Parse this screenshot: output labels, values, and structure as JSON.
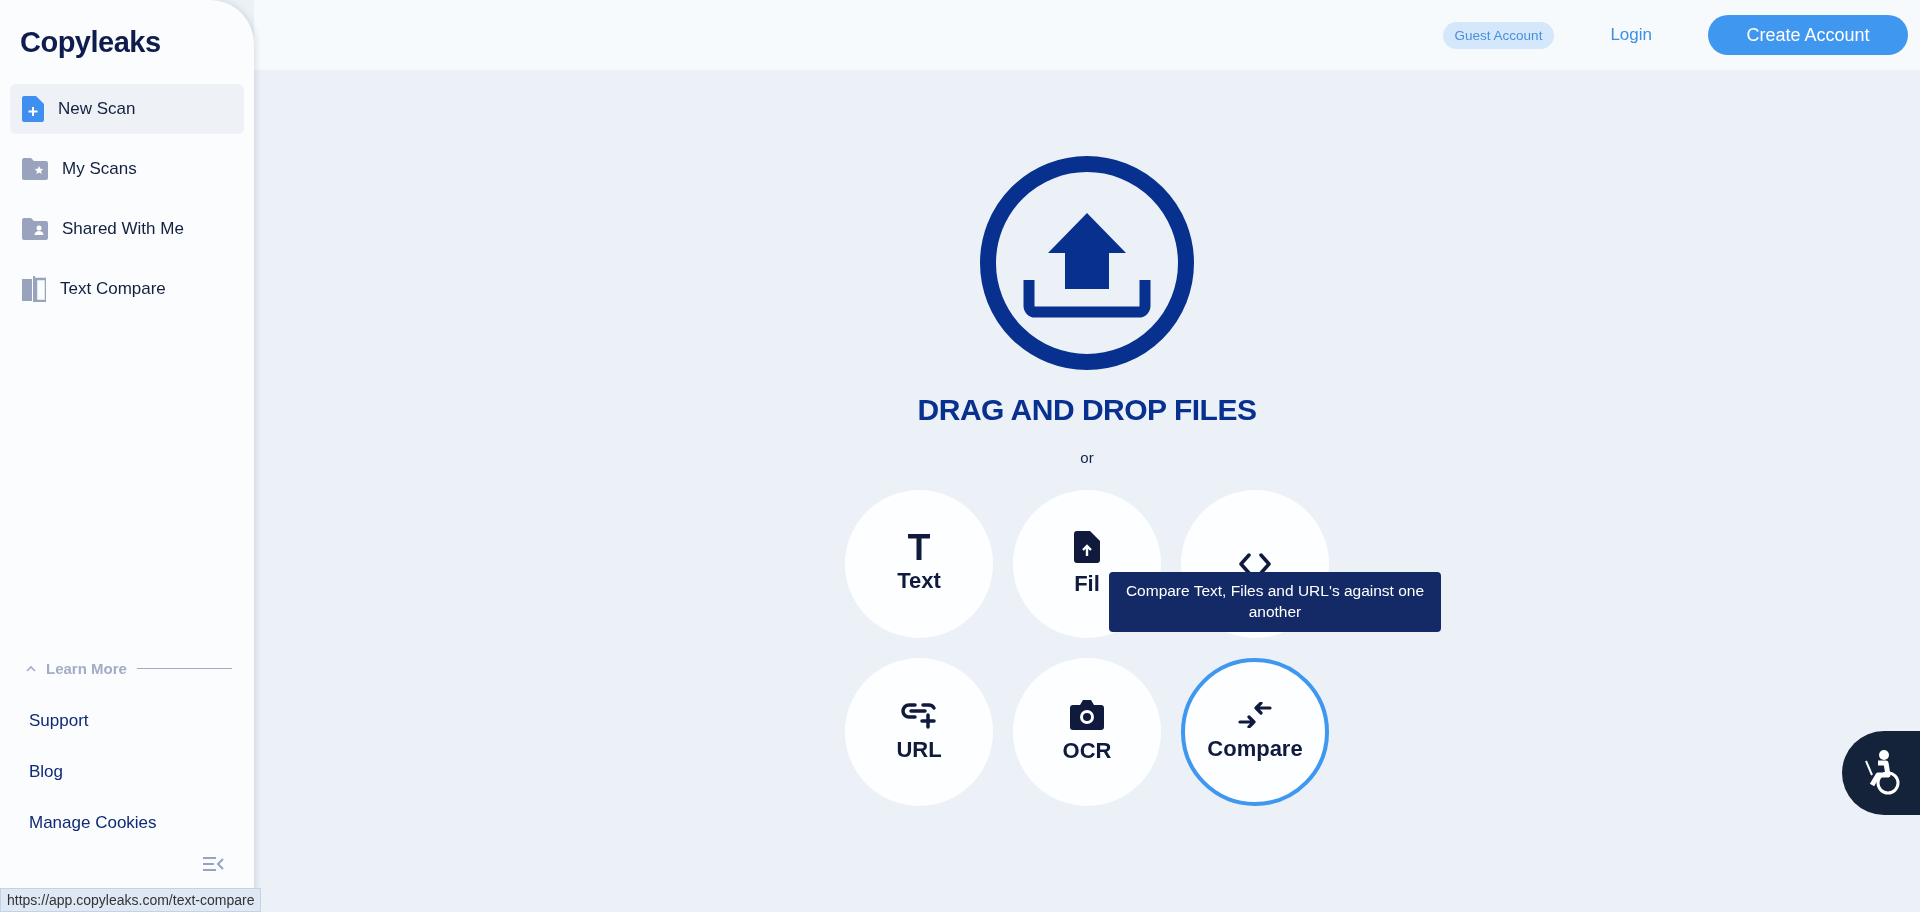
{
  "sidebar": {
    "logo": "Copyleaks",
    "items": [
      {
        "label": "New Scan",
        "kind": "new",
        "selected": true
      },
      {
        "label": "My Scans",
        "kind": "starred",
        "selected": false
      },
      {
        "label": "Shared With Me",
        "kind": "shared",
        "selected": false
      },
      {
        "label": "Text Compare",
        "kind": "compare",
        "selected": false
      }
    ],
    "learn_more": {
      "title": "Learn More",
      "expanded": true,
      "links": [
        "Support",
        "Blog",
        "Manage Cookies"
      ]
    }
  },
  "header": {
    "badge": "Guest Account",
    "login": "Login",
    "create": "Create Account"
  },
  "upload": {
    "title": "DRAG AND DROP FILES",
    "or": "or"
  },
  "options": [
    {
      "kind": "text",
      "label": "Text",
      "selected": false
    },
    {
      "kind": "file",
      "label": "Fil",
      "selected": false
    },
    {
      "kind": "code",
      "selected": false
    },
    {
      "kind": "url",
      "label": "URL",
      "selected": false
    },
    {
      "kind": "ocr",
      "label": "OCR",
      "selected": false
    },
    {
      "kind": "compare",
      "label": "Compare",
      "selected": true
    }
  ],
  "tooltip": "Compare Text, Files and URL's against one another",
  "status_url": "https://app.copyleaks.com/text-compare"
}
